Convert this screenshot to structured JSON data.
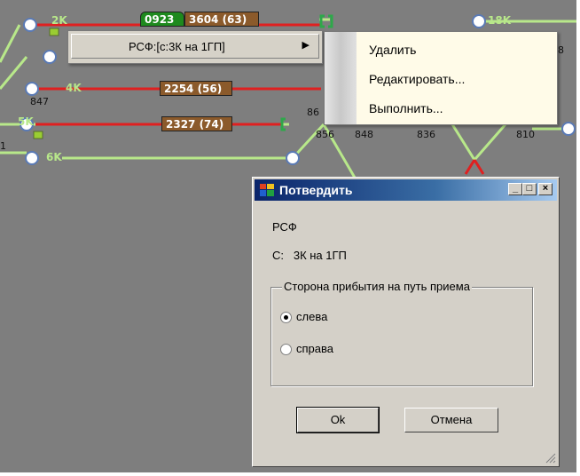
{
  "scheme": {
    "track_labels": [
      "2K",
      "4K",
      "5K",
      "6K",
      "18K"
    ],
    "numbers": [
      "847",
      "86",
      "856",
      "848",
      "836",
      "810",
      "8",
      "1"
    ],
    "trains": [
      {
        "text": "0923",
        "color": "#1e8a1e"
      },
      {
        "text": "3604 (63)",
        "color": "#8b5a2b"
      },
      {
        "text": "2254 (56)",
        "color": "#8b5a2b"
      },
      {
        "text": "2327 (74)",
        "color": "#8b5a2b"
      }
    ],
    "colors": {
      "track_green": "#b8e88a",
      "track_red": "#e02020",
      "background": "#7e7e7e"
    }
  },
  "context_menu": {
    "item_label": "РСФ:[с:3К на 1ГП]",
    "arrow": "▶"
  },
  "submenu": {
    "items": [
      "Удалить",
      "Редактировать...",
      "Выполнить..."
    ]
  },
  "dialog": {
    "title": "Потвердить",
    "line1": "РСФ",
    "line2": "С:   3К на 1ГП",
    "group_label": "Сторона прибытия на путь приема",
    "options": [
      {
        "label": "слева",
        "selected": true
      },
      {
        "label": "справа",
        "selected": false
      }
    ],
    "ok_label": "Ok",
    "cancel_label": "Отмена",
    "window_buttons": {
      "minimize": "_",
      "maximize": "□",
      "close": "×"
    }
  }
}
